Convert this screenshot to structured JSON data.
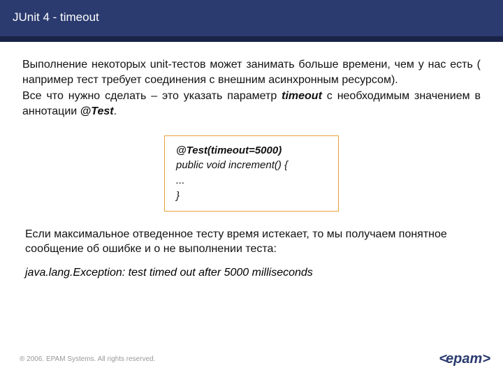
{
  "header": {
    "title": "JUnit 4 - timeout"
  },
  "body": {
    "p1a": "Выполнение некоторых unit-тестов может занимать больше времени, чем у нас есть ( например тест требует соединения с внешним асинхронным ресурсом).",
    "p1b_pre": "Все что нужно сделать – это указать параметр ",
    "p1b_kw1": "timeout",
    "p1b_mid": " с необходимым значением в аннотации ",
    "p1b_kw2": "@Test",
    "p1b_post": "."
  },
  "code": {
    "annotation": "@Test(timeout=5000)",
    "line2": "public void increment() {",
    "line3": "   ...",
    "line4": "}"
  },
  "body2": {
    "p2": "Если максимальное отведенное тесту время истекает, то мы получаем понятное сообщение об ошибке и о не выполнении теста:",
    "err": "java.lang.Exception: test timed out after 5000 milliseconds"
  },
  "footer": {
    "copyright": "® 2006. EPAM Systems. All rights reserved.",
    "logo_chev": "<",
    "logo_text": "epam",
    "logo_chev2": ">"
  }
}
